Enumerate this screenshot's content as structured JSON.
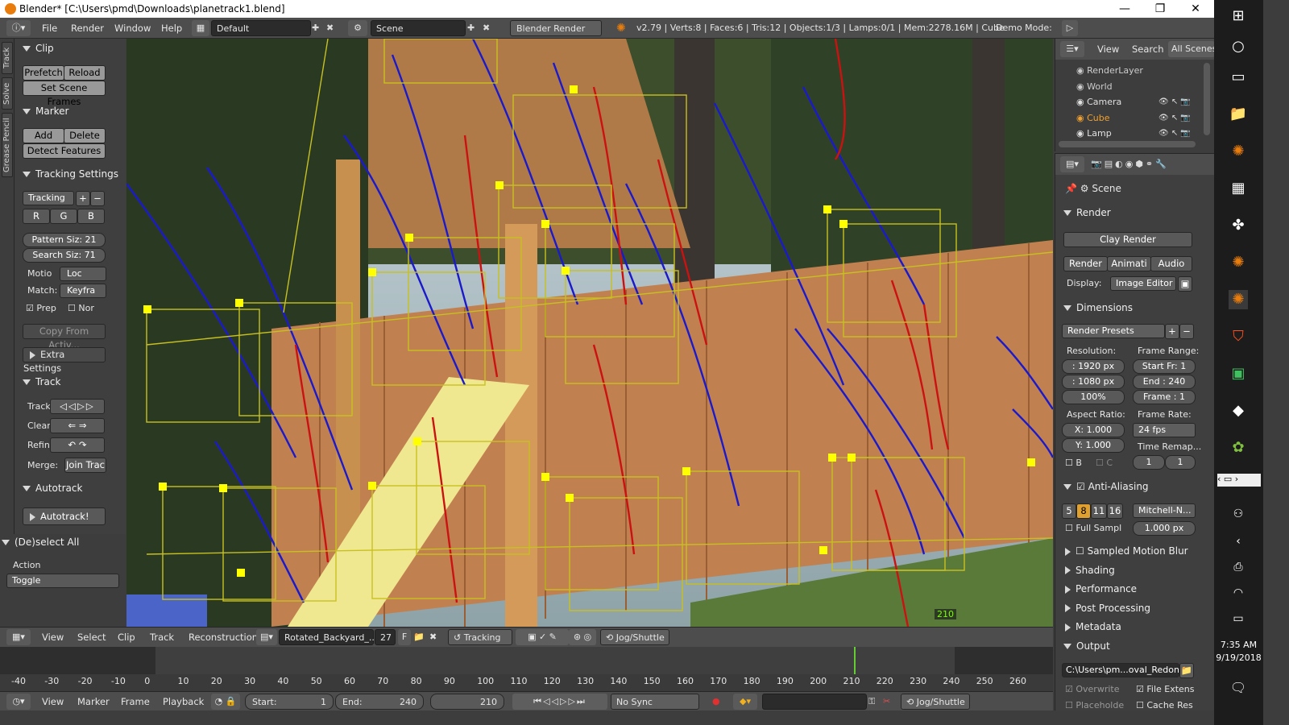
{
  "window": {
    "title": "Blender* [C:\\Users\\pmd\\Downloads\\planetrack1.blend]",
    "minimize": "—",
    "restore": "❐",
    "close": "✕"
  },
  "infobar": {
    "menus": [
      "File",
      "Render",
      "Window",
      "Help"
    ],
    "screen": "Default",
    "scene": "Scene",
    "engine": "Blender Render",
    "stats": "v2.79 | Verts:8 | Faces:6 | Tris:12 | Objects:1/3 | Lamps:0/1 | Mem:2278.16M | Cube",
    "demo_label": "Demo Mode:"
  },
  "left_tabs": [
    "Track",
    "Solve",
    "Grease Pencil"
  ],
  "toolshelf": {
    "clip": {
      "title": "Clip",
      "prefetch": "Prefetch",
      "reload": "Reload",
      "set_scene_frames": "Set Scene Frames"
    },
    "marker": {
      "title": "Marker",
      "add": "Add",
      "delete": "Delete",
      "detect": "Detect Features"
    },
    "tracking_settings": {
      "title": "Tracking Settings",
      "preset": "Tracking",
      "r": "R",
      "g": "G",
      "b": "B",
      "pattern": "Pattern Siz: 21",
      "search": "Search Siz: 71",
      "motion_label": "Motio",
      "motion_value": "Loc",
      "match_label": "Match:",
      "match_value": "Keyfra",
      "prepass": "Prep",
      "normalize": "Nor",
      "copy_from_active": "Copy From Activ...",
      "extra": "Extra Settings"
    },
    "track": {
      "title": "Track",
      "track_label": "Track",
      "clear_label": "Clear",
      "refine_label": "Refin",
      "merge_label": "Merge:",
      "join": "Join Trac"
    },
    "autotrack": {
      "title": "Autotrack",
      "button": "Autotrack!"
    }
  },
  "operator": {
    "title": "(De)select All",
    "action_label": "Action",
    "action_value": "Toggle"
  },
  "clipbar": {
    "menus": [
      "View",
      "Select",
      "Clip",
      "Track",
      "Reconstruction"
    ],
    "clip_name": "Rotated_Backyard_...",
    "users": "27",
    "fake": "F",
    "mode": "Tracking",
    "jog": "Jog/Shuttle"
  },
  "timeline": {
    "ticks": [
      "-40",
      "-30",
      "-20",
      "-10",
      "0",
      "10",
      "20",
      "30",
      "40",
      "50",
      "60",
      "70",
      "80",
      "90",
      "100",
      "110",
      "120",
      "130",
      "140",
      "150",
      "160",
      "170",
      "180",
      "190",
      "200",
      "210",
      "220",
      "230",
      "240",
      "250",
      "260"
    ],
    "current_frame_label": "210"
  },
  "tlbar": {
    "menus": [
      "View",
      "Marker",
      "Frame",
      "Playback"
    ],
    "start": "Start:",
    "start_val": "1",
    "end": "End:",
    "end_val": "240",
    "current": "210",
    "sync": "No Sync",
    "jog": "Jog/Shuttle"
  },
  "outliner": {
    "menus": [
      "View",
      "Search"
    ],
    "filter": "All Scenes",
    "items": [
      {
        "label": "RenderLayer",
        "color": "#cccccc"
      },
      {
        "label": "World",
        "color": "#cccccc"
      },
      {
        "label": "Camera",
        "color": "#e0e0e0"
      },
      {
        "label": "Cube",
        "color": "#f0a030"
      },
      {
        "label": "Lamp",
        "color": "#e0e0e0"
      }
    ]
  },
  "properties": {
    "context": "Scene",
    "render": {
      "title": "Render",
      "preset": "Clay Render",
      "tab_render": "Render",
      "tab_anim": "Animati",
      "tab_audio": "Audio",
      "display_label": "Display:",
      "display_value": "Image Editor"
    },
    "dimensions": {
      "title": "Dimensions",
      "presets": "Render Presets",
      "resolution_label": "Resolution:",
      "res_x": ": 1920 px",
      "res_y": ": 1080 px",
      "res_pct": "100%",
      "frame_range_label": "Frame Range:",
      "start_fr": "Start Fr: 1",
      "end_fr": "End : 240",
      "frame": "Frame : 1",
      "aspect_label": "Aspect Ratio:",
      "aspect_x": "X:  1.000",
      "aspect_y": "Y:  1.000",
      "frame_rate_label": "Frame Rate:",
      "fps": "24 fps",
      "border": "B",
      "crop": "C",
      "time_remap_label": "Time Remap...",
      "remap_old": "1",
      "remap_new": "1"
    },
    "aa": {
      "title": "Anti-Aliasing",
      "samples": [
        "5",
        "8",
        "11",
        "16"
      ],
      "filter": "Mitchell-N...",
      "full_sample": "Full Sampl",
      "size": "1.000 px"
    },
    "collapsed": [
      "Sampled Motion Blur",
      "Shading",
      "Performance",
      "Post Processing",
      "Metadata"
    ],
    "output": {
      "title": "Output",
      "path": "C:\\Users\\pm...oval_Redone",
      "overwrite": "Overwrite",
      "file_ext": "File Extens",
      "placeholders": "Placeholde",
      "cache": "Cache Res"
    }
  },
  "viewport": {
    "frame_label": "210"
  },
  "taskbar": {
    "time": "7:35 AM",
    "date": "9/19/2018"
  },
  "colors": {
    "accent": "#e87d0d",
    "track_yellow": "#ffff00",
    "path_blue": "#1a1acc",
    "path_red": "#cc1111"
  }
}
